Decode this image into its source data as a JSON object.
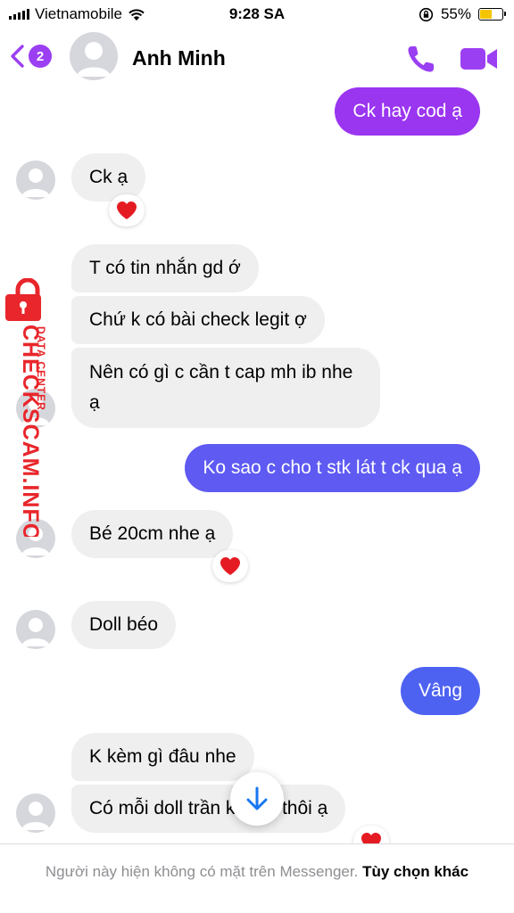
{
  "status_bar": {
    "carrier": "Vietnamobile",
    "time": "9:28 SA",
    "battery": "55%",
    "battery_level": 0.55
  },
  "header": {
    "back_badge": "2",
    "contact_name": "Anh Minh",
    "call_icon": "phone-icon",
    "video_icon": "video-camera-icon"
  },
  "colors": {
    "accent": "#9b3ff2",
    "outgoing_top": "#a033f0",
    "outgoing_bottom": "#5a5cf2",
    "incoming": "#efeff0",
    "watermark": "#e8262b"
  },
  "messages": [
    {
      "sender": "me",
      "text": "Ck hay cod ạ"
    },
    {
      "sender": "them",
      "text": "Ck ạ",
      "reaction": "heart"
    },
    {
      "sender": "them",
      "text": "T có tin nhắn gd ớ"
    },
    {
      "sender": "them",
      "text": "Chứ k có bài check legit ợ"
    },
    {
      "sender": "them",
      "text": "Nên có gì c cần t cap mh ib nhe ạ"
    },
    {
      "sender": "me",
      "text": "Ko sao c cho t stk lát t ck qua ạ"
    },
    {
      "sender": "them",
      "text": "Bé 20cm nhe ạ",
      "reaction": "heart"
    },
    {
      "sender": "them",
      "text": "Doll béo"
    },
    {
      "sender": "me",
      "text": "Vâng"
    },
    {
      "sender": "them",
      "text": "K kèm gì đâu nhe"
    },
    {
      "sender": "them",
      "text": "Có mỗi doll trần không thôi ạ",
      "reaction": "heart"
    }
  ],
  "watermark": {
    "main": "CHECKSCAM.INFO",
    "sub": "DATA CENTER"
  },
  "footer": {
    "notice": "Người này hiện không có mặt trên Messenger.",
    "more_options": "Tùy chọn khác"
  }
}
